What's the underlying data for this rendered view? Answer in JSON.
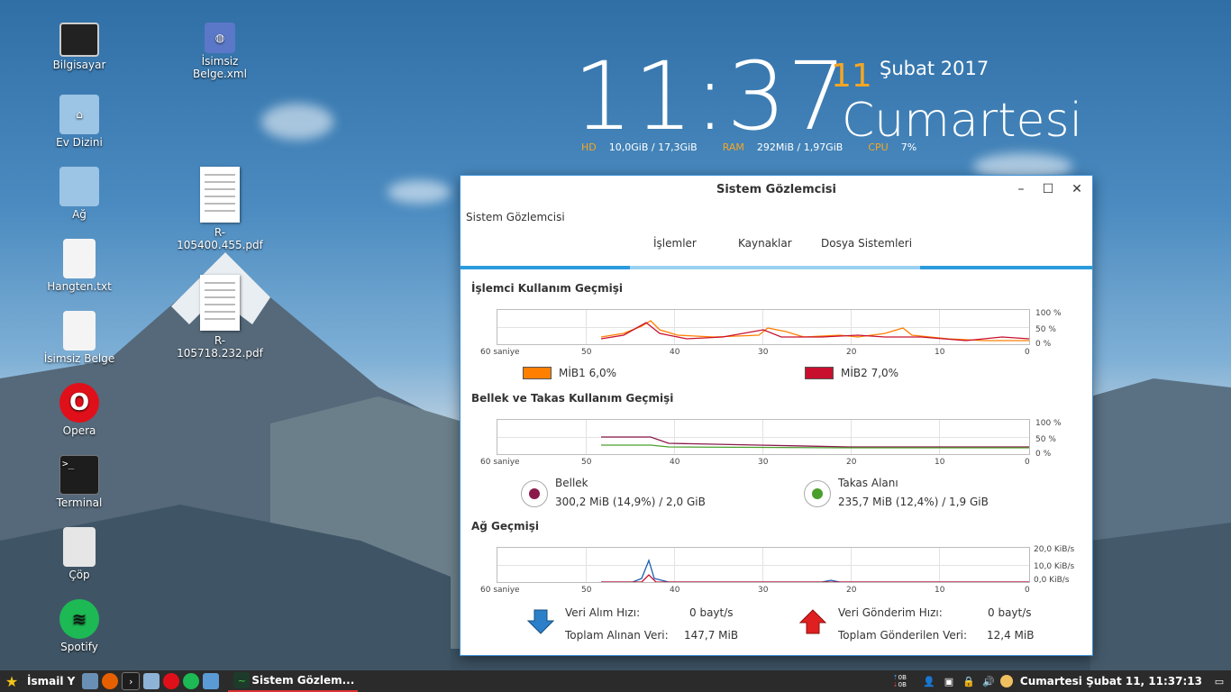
{
  "desktop": {
    "icons": [
      {
        "label": "Bilgisayar"
      },
      {
        "label": "Ev Dizini"
      },
      {
        "label": "Ağ"
      },
      {
        "label": "Hangten.txt"
      },
      {
        "label": "İsimsiz Belge"
      },
      {
        "label": "Opera"
      },
      {
        "label": "Terminal"
      },
      {
        "label": "Çöp"
      },
      {
        "label": "Spotify"
      },
      {
        "label": "İsimsiz Belge.xml"
      },
      {
        "label": "R-105400.455.pdf"
      },
      {
        "label": "R-105718.232.pdf"
      }
    ]
  },
  "conky": {
    "time": "11:37",
    "day": "11",
    "month_year": "Şubat 2017",
    "weekday": "Cumartesi",
    "hd_label": "HD",
    "hd_value": "10,0GiB / 17,3GiB",
    "ram_label": "RAM",
    "ram_value": "292MiB / 1,97GiB",
    "cpu_label": "CPU",
    "cpu_value": "7%",
    "accent": "#f5a623"
  },
  "window": {
    "title": "Sistem Gözlemcisi",
    "menu_label": "Sistem Gözlemcisi",
    "tabs": [
      "İşlemler",
      "Kaynaklar",
      "Dosya Sistemleri"
    ],
    "selected_tab": "Kaynaklar",
    "cpu": {
      "title": "İşlemci Kullanım Geçmişi",
      "cpu1_label": "MİB1",
      "cpu1_value": "6,0%",
      "cpu1_color": "#ff7f00",
      "cpu2_label": "MİB2",
      "cpu2_value": "7,0%",
      "cpu2_color": "#c8102e"
    },
    "memory": {
      "title": "Bellek ve Takas Kullanım Geçmişi",
      "mem_label": "Bellek",
      "mem_value": "300,2 MiB (14,9%) / 2,0 GiB",
      "mem_color": "#8b1a4a",
      "swap_label": "Takas Alanı",
      "swap_value": "235,7 MiB (12,4%) / 1,9 GiB",
      "swap_color": "#4aa02c"
    },
    "network": {
      "title": "Ağ Geçmişi",
      "rx_label": "Veri Alım Hızı:",
      "rx_value": "0 bayt/s",
      "rx_total_label": "Toplam Alınan Veri:",
      "rx_total_value": "147,7 MiB",
      "tx_label": "Veri Gönderim Hızı:",
      "tx_value": "0 bayt/s",
      "tx_total_label": "Toplam Gönderilen Veri:",
      "tx_total_value": "12,4 MiB"
    },
    "axis": {
      "x_ticks": [
        "60 saniye",
        "50",
        "40",
        "30",
        "20",
        "10",
        "0"
      ],
      "pct_ticks": [
        "100 %",
        "50 %",
        "0 %"
      ],
      "net_ticks": [
        "20,0 KiB/s",
        "10,0 KiB/s",
        "0,0 KiB/s"
      ]
    }
  },
  "taskbar": {
    "user": "İsmail Y",
    "active_window": "Sistem Gözlem...",
    "net_up": "0B",
    "net_down": "0B",
    "clock": "Cumartesi Şubat 11, 11:37:13"
  }
}
